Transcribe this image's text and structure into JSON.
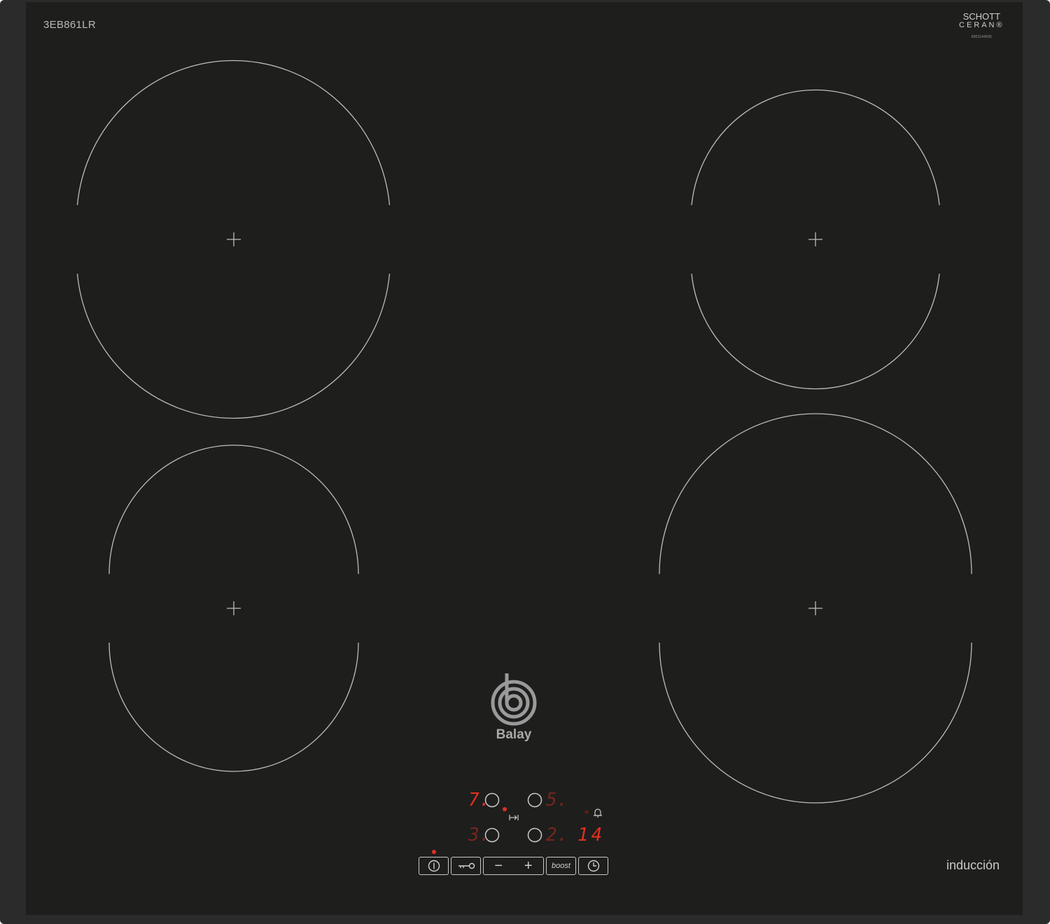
{
  "model": "3EB861LR",
  "schott": {
    "line1": "SCHOTT",
    "line2": "CERAN®",
    "code": "9001144925"
  },
  "brand": "Balay",
  "type_label": "inducción",
  "displays": {
    "front_left": "7.",
    "rear_left": "3.",
    "front_right": "5.",
    "rear_right": "2.",
    "timer": "14"
  },
  "controls": {
    "boost_label": "boost",
    "minus_label": "−",
    "plus_label": "+"
  },
  "colors": {
    "glass": "#1e1e1d",
    "frame": "#2b2b2b",
    "zone_line": "#bdbdbd",
    "led_red": "#e0301e"
  }
}
